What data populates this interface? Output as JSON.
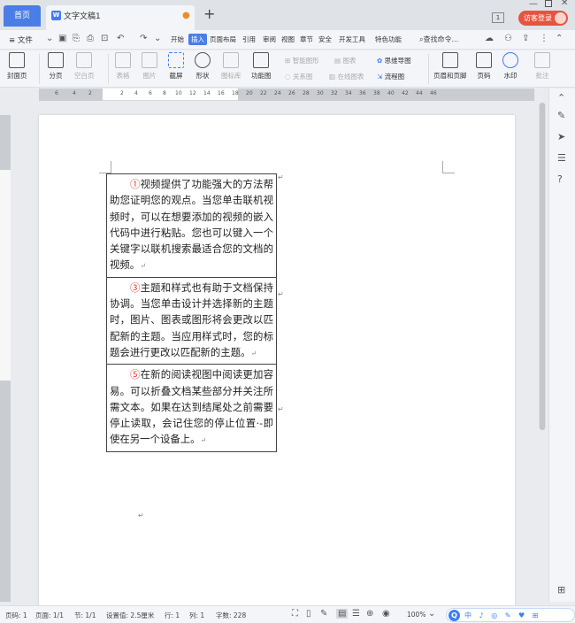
{
  "tabbar": {
    "home_label": "首页",
    "doc_tab_label": "文字文稿1",
    "doc_icon": "W",
    "add_tab": "+",
    "window_count": "1",
    "login_label": "访客登录"
  },
  "menubar": {
    "file_label": "≡ 文件",
    "items": [
      "开始",
      "插入",
      "页面布局",
      "引用",
      "审阅",
      "视图",
      "章节",
      "安全",
      "开发工具",
      "特色功能"
    ],
    "active_item": "插入",
    "search_label": "查找命令..."
  },
  "ribbon": {
    "cover_page": "封面页",
    "page_break": "分页",
    "blank_page": "空白页",
    "table": "表格",
    "picture": "图片",
    "screenshot": "截屏",
    "shape": "形状",
    "icon_lib": "图标库",
    "function_chart": "功能图",
    "smart_shape": "智能图形",
    "chart": "图表",
    "mind_map": "思维导图",
    "relation_chart": "关系图",
    "online_chart": "在线图表",
    "flowchart": "流程图",
    "header_footer": "页眉和页脚",
    "page_number": "页码",
    "watermark": "水印",
    "comment": "批注"
  },
  "ruler": {
    "left_numbers": [
      "6",
      "4",
      "2"
    ],
    "numbers": [
      "2",
      "4",
      "6",
      "8",
      "10",
      "12",
      "14",
      "16",
      "18",
      "20",
      "22",
      "24",
      "26",
      "28",
      "30",
      "32",
      "34",
      "36",
      "38",
      "40",
      "42",
      "44",
      "46"
    ]
  },
  "document": {
    "cells": [
      {
        "num": "①",
        "text": "视频提供了功能强大的方法帮助您证明您的观点。当您单击联机视频时，可以在想要添加的视频的嵌入代码中进行粘贴。您也可以键入一个关键字以联机搜索最适合您的文档的视频。"
      },
      {
        "num": "③",
        "text": "主题和样式也有助于文档保持协调。当您单击设计并选择新的主题时，图片、图表或图形将会更改以匹配新的主题。当应用样式时，您的标题会进行更改以匹配新的主题。"
      },
      {
        "num": "⑤",
        "text": "在新的阅读视图中阅读更加容易。可以折叠文档某些部分并关注所需文本。如果在达到结尾处之前需要停止读取，会记住您的停止位置·-即使在另一个设备上。"
      }
    ],
    "para_mark": "↵",
    "cell_mark": "↵"
  },
  "status": {
    "page_num": "页码: 1",
    "pages": "页面: 1/1",
    "section": "节: 1/1",
    "setting": "设置值: 2.5厘米",
    "line": "行: 1",
    "column": "列: 1",
    "word_count": "字数: 228",
    "zoom": "100%",
    "ime_text": "中 ♪ ◎ ✎ ♥ ⊞"
  }
}
